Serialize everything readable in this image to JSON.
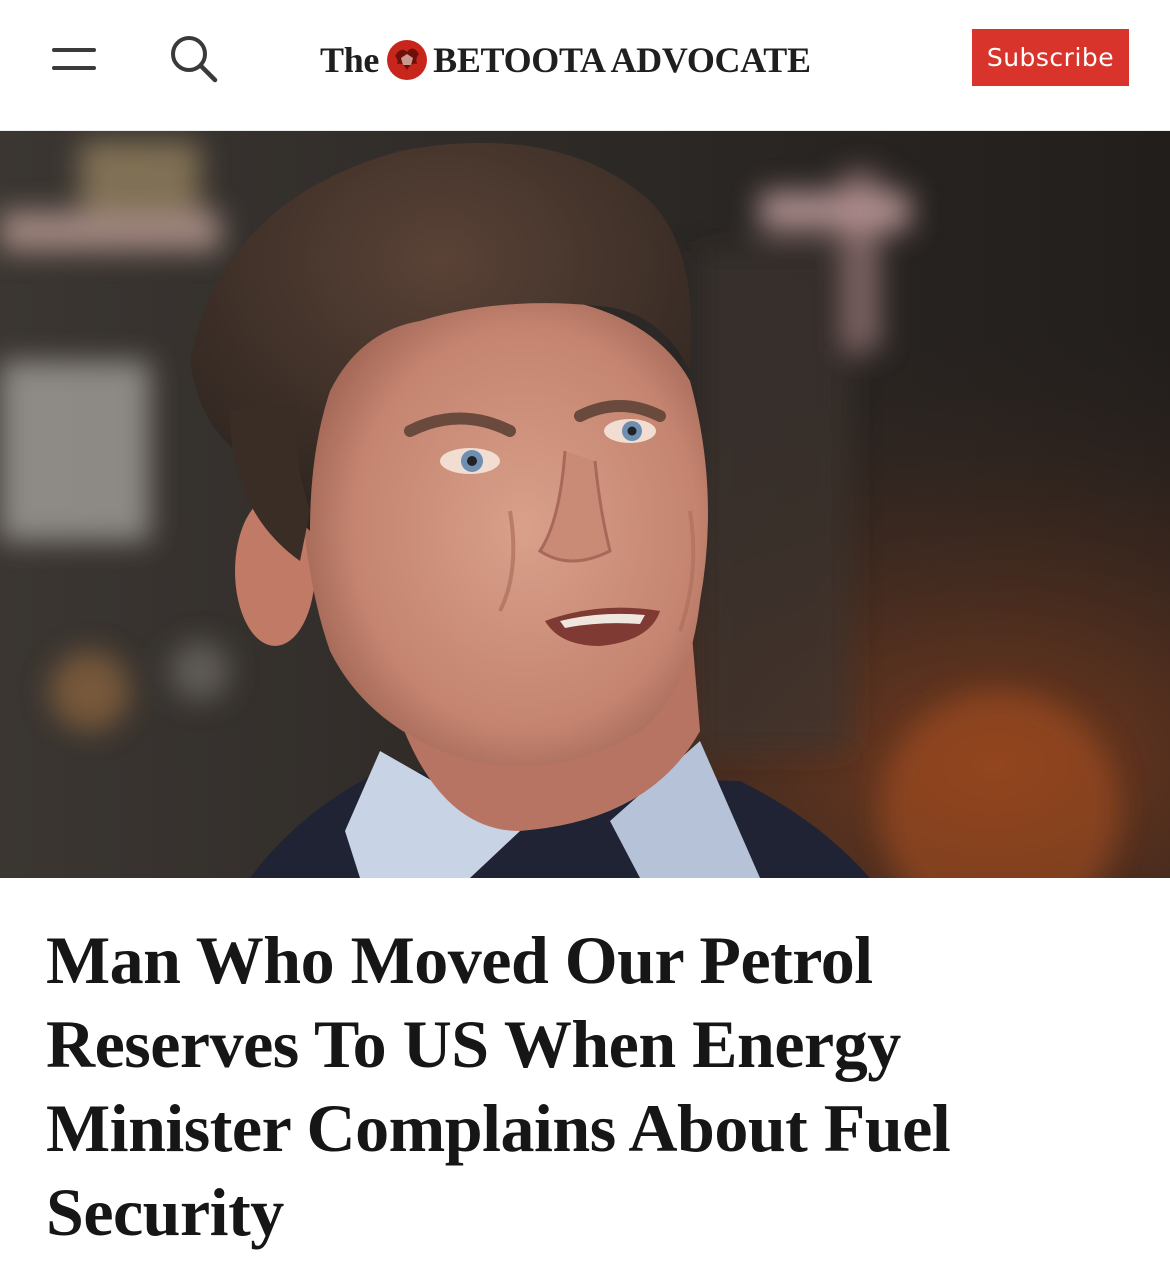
{
  "header": {
    "menu_icon": "hamburger-menu-icon",
    "search_icon": "search-icon",
    "logo_prefix": "The",
    "logo_emblem": "red-crest-emblem",
    "logo_name": "BETOOTA ADVOCATE",
    "subscribe_label": "Subscribe",
    "accent_color": "#d9342b"
  },
  "article": {
    "hero_image": "photo of a middle-aged man with greying brown hair and blue eyes, mouth open mid-speech, wearing a light blue collared shirt and dark jacket against a blurred warm background",
    "headline": "Man Who Moved Our Petrol Reserves To US When Energy Minister Complains About Fuel Security"
  }
}
